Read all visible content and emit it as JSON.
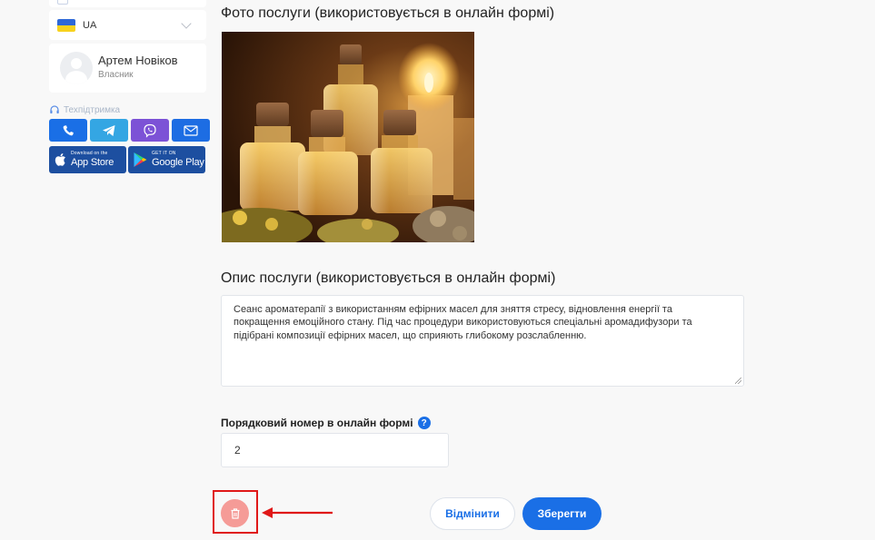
{
  "sidebar": {
    "language": {
      "code": "UA",
      "flag_colors": [
        "#2d68d8",
        "#f7d21e"
      ]
    },
    "user": {
      "name": "Артем Новіков",
      "role": "Власник"
    },
    "support": {
      "label": "Техпідтримка",
      "contacts": [
        {
          "icon": "phone-icon",
          "color": "#1a6fe6"
        },
        {
          "icon": "telegram-icon",
          "color": "#34a6e3"
        },
        {
          "icon": "viber-icon",
          "color": "#7c52d6"
        },
        {
          "icon": "mail-icon",
          "color": "#1d6de3"
        }
      ]
    },
    "stores": [
      {
        "small": "Download on the",
        "big": "App Store",
        "icon": "apple-icon"
      },
      {
        "small": "GET IT ON",
        "big": "Google Play",
        "icon": "google-play-icon"
      }
    ]
  },
  "main": {
    "photo_title": "Фото послуги (використовується в онлайн формі)",
    "description_title": "Опис послуги (використовується в онлайн формі)",
    "description_text": "Сеанс ароматерапії з використанням ефірних масел для зняття стресу, відновлення енергії та покращення емоційного стану. Під час процедури використовуються спеціальні аромадифузори та підібрані композиції ефірних масел, що сприяють глибокому розслабленню.",
    "order_label": "Порядковий номер в онлайн формі",
    "order_help": "?",
    "order_value": "2"
  },
  "actions": {
    "cancel_label": "Відмінити",
    "save_label": "Зберегти",
    "delete_icon": "trash-icon",
    "accent_color": "#1a6fe6",
    "delete_color": "#f59b97",
    "highlight_color": "#e01818"
  }
}
